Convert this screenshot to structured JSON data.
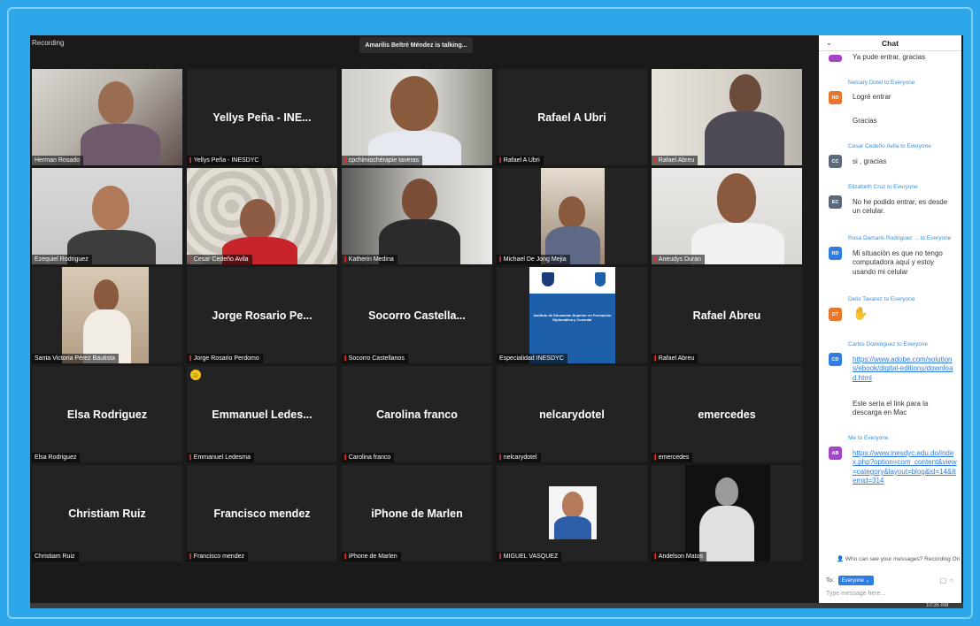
{
  "window": {
    "recording_label": "Recording",
    "talking_banner": "Amarilis Beltré Méndez is talking..."
  },
  "tiles": [
    {
      "id": "t1",
      "center": "",
      "label": "Herman Rosado",
      "muted": false,
      "video": true
    },
    {
      "id": "t2",
      "center": "Yellys Peña - INE...",
      "label": "Yellys Peña - INESDYC",
      "muted": true,
      "video": false
    },
    {
      "id": "t3",
      "center": "",
      "label": "cpchimiochérapie taveras",
      "muted": true,
      "video": true
    },
    {
      "id": "t4",
      "center": "Rafael A Ubri",
      "label": "Rafael A Ubri",
      "muted": true,
      "video": false
    },
    {
      "id": "t5",
      "center": "",
      "label": "Rafael Abreu",
      "muted": true,
      "video": true
    },
    {
      "id": "t6",
      "center": "",
      "label": "Ezequiel Rodriguez",
      "muted": false,
      "video": true
    },
    {
      "id": "t7",
      "center": "",
      "label": "Cesar Cedeño Avila",
      "muted": true,
      "video": true
    },
    {
      "id": "t8",
      "center": "",
      "label": "Katherin Medina",
      "muted": true,
      "video": true
    },
    {
      "id": "t9",
      "center": "",
      "label": "Michael De Jong Mejia",
      "muted": true,
      "video": true
    },
    {
      "id": "t10",
      "center": "",
      "label": "Aneudys Duran",
      "muted": true,
      "video": true
    },
    {
      "id": "t11",
      "center": "",
      "label": "Santa Victoria Pérez Bautista",
      "muted": false,
      "video": true
    },
    {
      "id": "t12",
      "center": "Jorge Rosario Pe...",
      "label": "Jorge Rosario Perdomo",
      "muted": true,
      "video": false
    },
    {
      "id": "t13",
      "center": "Socorro Castella...",
      "label": "Socorro Castellanos",
      "muted": true,
      "video": false
    },
    {
      "id": "t14",
      "center": "",
      "label": "Especialidad INESDYC",
      "muted": false,
      "video": true
    },
    {
      "id": "t15",
      "center": "Rafael Abreu",
      "label": "Rafael Abreu",
      "muted": true,
      "video": false
    },
    {
      "id": "t16",
      "center": "Elsa Rodriguez",
      "label": "Elsa Rodriguez",
      "muted": false,
      "video": false
    },
    {
      "id": "t17",
      "center": "Emmanuel Ledes...",
      "label": "Emmanuel Ledesma",
      "muted": true,
      "video": false
    },
    {
      "id": "t18",
      "center": "Carolina franco",
      "label": "Carolina franco",
      "muted": true,
      "video": false
    },
    {
      "id": "t19",
      "center": "nelcarydotel",
      "label": "nelcarydotel",
      "muted": true,
      "video": false
    },
    {
      "id": "t20",
      "center": "emercedes",
      "label": "emercedes",
      "muted": true,
      "video": false
    },
    {
      "id": "t21",
      "center": "Christiam Ruiz",
      "label": "Christiam Ruiz",
      "muted": false,
      "video": false
    },
    {
      "id": "t22",
      "center": "Francisco mendez",
      "label": "Francisco mendez",
      "muted": true,
      "video": false
    },
    {
      "id": "t23",
      "center": "iPhone de Marlen",
      "label": "iPhone de Marlen",
      "muted": true,
      "video": false
    },
    {
      "id": "t24",
      "center": "",
      "label": "MIGUEL VASQUEZ",
      "muted": true,
      "video": true
    },
    {
      "id": "t25",
      "center": "",
      "label": "Andelson Matos",
      "muted": true,
      "video": true
    }
  ],
  "slide_text": "Instituto de Educación Superior en Formación Diplomática y Consular",
  "chat": {
    "title": "Chat",
    "messages": [
      {
        "avatar": "",
        "color": "#a545c9",
        "sender": "",
        "lines": [
          "Ya pude entrar, gracias"
        ]
      },
      {
        "avatar": "ND",
        "color": "#e8762c",
        "sender": "Nelcary Dotel to Everyone",
        "lines": [
          "Logré entrar",
          "Gracias"
        ]
      },
      {
        "avatar": "CC",
        "color": "#5a6a7a",
        "sender": "Cesar Cedeño Avila to Everyone",
        "lines": [
          "si , gracias"
        ]
      },
      {
        "avatar": "EC",
        "color": "#5a6a7a",
        "sender": "Elizabeth Cruz to Everyone",
        "lines": [
          "No he podido entrar, es desde un celular."
        ]
      },
      {
        "avatar": "RD",
        "color": "#2f7de1",
        "sender": "Rosa Damaris Rodriguez ...  to Everyone",
        "lines": [
          "Mi situación es que no tengo computadora aquí y estoy usando mi celular"
        ]
      },
      {
        "avatar": "DT",
        "color": "#e8762c",
        "sender": "Delis Tavarez to Everyone",
        "lines": [
          "✋"
        ]
      },
      {
        "avatar": "CD",
        "color": "#2f7de1",
        "sender": "Carlos Dominguez to Everyone",
        "link": "https://www.adobe.com/solutions/ebook/digital-editions/download.html",
        "lines": [
          "Este sería el link para la descarga en Mac"
        ]
      },
      {
        "avatar": "AB",
        "color": "#a545c9",
        "sender": "Me to Everyone",
        "link": "https://www.inesdyc.edu.do/index.php?option=com_content&view=category&layout=blog&id=14&Itemid=314",
        "lines": []
      }
    ],
    "who_can_see": "Who can see your messages? Recording On",
    "to_label": "To:",
    "to_value": "Everyone ⌄",
    "placeholder": "Type message here..."
  },
  "clock": "10:35 AM"
}
